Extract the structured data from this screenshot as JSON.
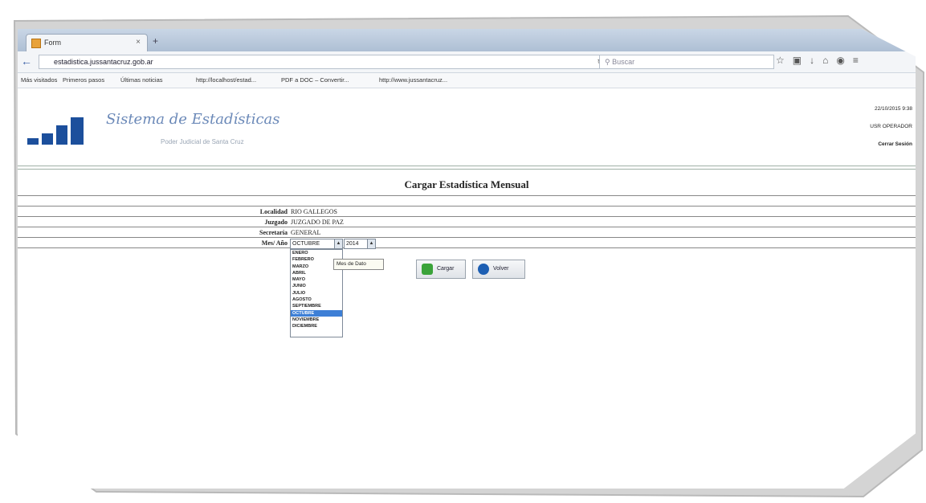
{
  "browser": {
    "tab_title": "Form",
    "tab_close": "×",
    "new_tab": "+",
    "url": "estadistica.jussantacruz.gob.ar",
    "search_placeholder": "Buscar",
    "bookmarks": [
      "Más visitados",
      "Primeros pasos",
      "Últimas noticias",
      "http://localhost/estad...",
      "PDF a DOC – Convertir...",
      "http://www.jussantacruz..."
    ]
  },
  "header": {
    "system_title": "Sistema de Estadísticas",
    "subtitle": "Poder Judicial de Santa Cruz",
    "date": "22/10/2015 9:38",
    "user": "USR OPERADOR",
    "logout": "Cerrar Sesión"
  },
  "form": {
    "title": "Cargar Estadística Mensual",
    "rows": [
      {
        "label": "Localidad",
        "value": "RIO GALLEGOS"
      },
      {
        "label": "Juzgado",
        "value": "JUZGADO DE PAZ"
      },
      {
        "label": "Secretaría",
        "value": "GENERAL"
      }
    ],
    "period_label": "Mes/ Año",
    "month_selected": "OCTUBRE",
    "year_selected": "2014",
    "months": [
      "ENERO",
      "FEBRERO",
      "MARZO",
      "ABRIL",
      "MAYO",
      "JUNIO",
      "JULIO",
      "AGOSTO",
      "SEPTIEMBRE",
      "OCTUBRE",
      "NOVIEMBRE",
      "DICIEMBRE"
    ],
    "tooltip": "Mes de Dato",
    "load_button": "Cargar",
    "back_button": "Volver"
  }
}
